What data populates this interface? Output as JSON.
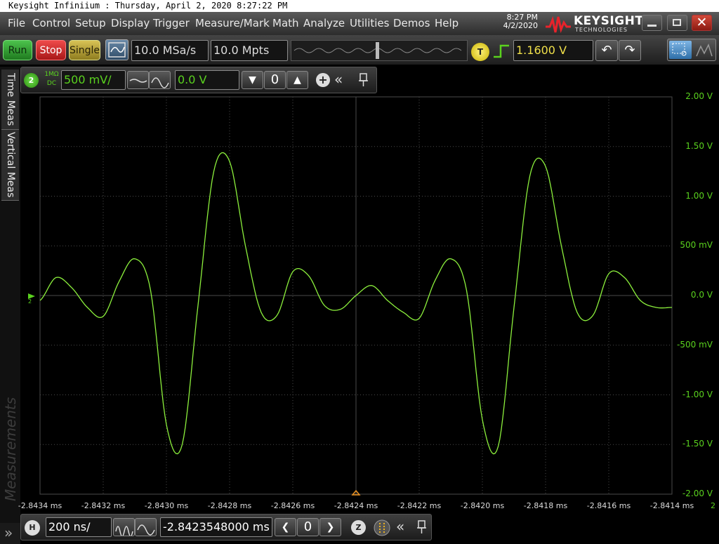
{
  "window": {
    "title": "Keysight Infiniium : Thursday, April 2, 2020 8:27:22 PM",
    "time": "8:27 PM",
    "date": "4/2/2020",
    "logo_name": "KEYSIGHT",
    "logo_sub": "TECHNOLOGIES"
  },
  "menu": [
    "File",
    "Control",
    "Setup",
    "Display",
    "Trigger",
    "Measure/Mark",
    "Math",
    "Analyze",
    "Utilities",
    "Demos",
    "Help"
  ],
  "toolbar": {
    "run_label": "Run",
    "stop_label": "Stop",
    "single_label": "Single",
    "sample_rate": "10.0 MSa/s",
    "memory_depth": "10.0 Mpts",
    "trigger_badge": "T",
    "trigger_level": "1.1600 V"
  },
  "channel": {
    "number": "2",
    "coupling_top": "1MΩ",
    "coupling_bottom": "DC",
    "scale": "500 mV/",
    "offset": "0.0 V",
    "ground_marker": "2"
  },
  "sidebar": {
    "tab_time": "Time Meas",
    "tab_vertical": "Vertical Meas",
    "measurements_label": "Measurements"
  },
  "timebase": {
    "badge": "H",
    "scale": "200 ns/",
    "position": "-2.8423548000 ms",
    "zoom_badge": "Z"
  },
  "colors": {
    "trace": "#8cf03c",
    "grid": "#4a4a4a",
    "axis_label": "#5ad21e",
    "stop_red": "#e03030",
    "run_green": "#2ea12e",
    "single_yellow": "#c9b330"
  },
  "chart_data": {
    "type": "line",
    "title": "",
    "xlabel": "",
    "ylabel": "",
    "y_axis_labels": [
      "2.00 V",
      "1.50 V",
      "1.00 V",
      "500 mV",
      "0.0 V",
      "-500 mV",
      "-1.00 V",
      "-1.50 V",
      "-2.00 V"
    ],
    "x_axis_labels": [
      "-2.8434 ms",
      "-2.8432 ms",
      "-2.8430 ms",
      "-2.8428 ms",
      "-2.8426 ms",
      "-2.8424 ms",
      "-2.8422 ms",
      "-2.8420 ms",
      "-2.8418 ms",
      "-2.8416 ms",
      "-2.8414 ms"
    ],
    "x_channel_marker": "2",
    "xlim": [
      -2.8434,
      -2.8414
    ],
    "ylim": [
      -2.0,
      2.0
    ],
    "grid": true,
    "series": [
      {
        "x": [
          -2.8434,
          -2.84335,
          -2.8433,
          -2.84325,
          -2.8432,
          -2.84315,
          -2.8431,
          -2.84305,
          -2.843,
          -2.84295,
          -2.8429,
          -2.84285,
          -2.8428,
          -2.84275,
          -2.8427,
          -2.84265,
          -2.8426,
          -2.84255,
          -2.8425,
          -2.84245,
          -2.8424,
          -2.84235,
          -2.8423,
          -2.84225,
          -2.8422,
          -2.84215,
          -2.8421,
          -2.84205,
          -2.842,
          -2.84195,
          -2.8419,
          -2.84185,
          -2.8418,
          -2.84175,
          -2.8417,
          -2.84165,
          -2.8416,
          -2.84155,
          -2.8415,
          -2.84145,
          -2.8414
        ],
        "y": [
          -0.05,
          0.18,
          0.08,
          -0.12,
          -0.21,
          0.14,
          0.37,
          0.05,
          -1.3,
          -1.5,
          -0.1,
          1.25,
          1.35,
          0.5,
          -0.17,
          -0.2,
          0.24,
          0.2,
          -0.1,
          -0.14,
          0.0,
          0.1,
          -0.05,
          -0.17,
          -0.23,
          0.15,
          0.37,
          0.05,
          -1.25,
          -1.52,
          -0.12,
          1.2,
          1.3,
          0.5,
          -0.17,
          -0.2,
          0.22,
          0.18,
          -0.05,
          -0.12,
          -0.12
        ]
      }
    ]
  }
}
